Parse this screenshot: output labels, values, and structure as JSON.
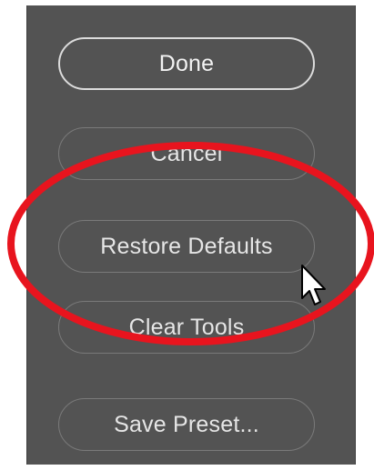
{
  "buttons": {
    "done": "Done",
    "cancel": "Cancel",
    "restore_defaults": "Restore Defaults",
    "clear_tools": "Clear Tools",
    "save_preset": "Save Preset..."
  },
  "colors": {
    "panel_bg": "#535353",
    "button_text": "#ededed",
    "highlight_ring": "#e8141e"
  },
  "icons": {
    "cursor": "arrow-pointer-icon",
    "highlight": "highlight-ellipse"
  }
}
